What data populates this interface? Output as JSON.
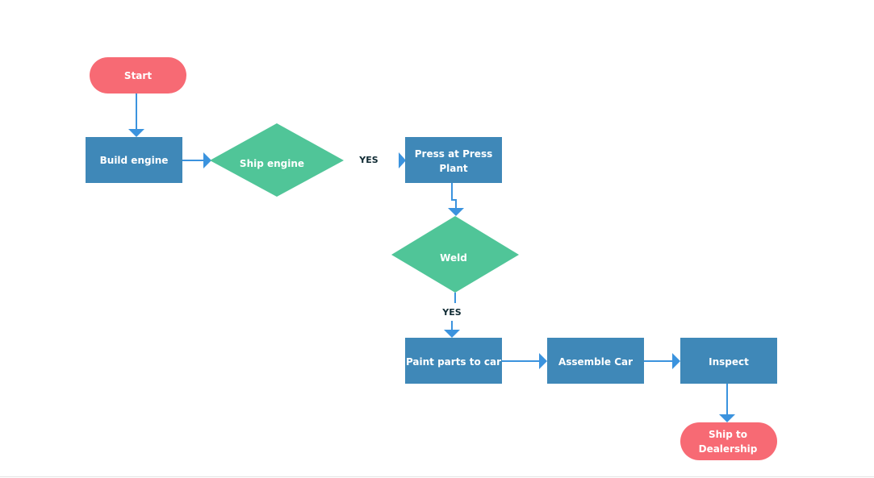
{
  "colors": {
    "terminal": "#f76a74",
    "process": "#3f88b8",
    "decision": "#50c598",
    "connector": "#3b93de"
  },
  "nodes": {
    "start": "Start",
    "build_engine": "Build engine",
    "ship_engine": "Ship engine",
    "press": [
      "Press at Press",
      "Plant"
    ],
    "weld": "Weld",
    "paint": "Paint parts to car",
    "assemble": "Assemble Car",
    "inspect": "Inspect",
    "ship_dealer": [
      "Ship to",
      "Dealership"
    ]
  },
  "edge_labels": {
    "ship_engine_yes": "YES",
    "weld_yes": "YES"
  }
}
